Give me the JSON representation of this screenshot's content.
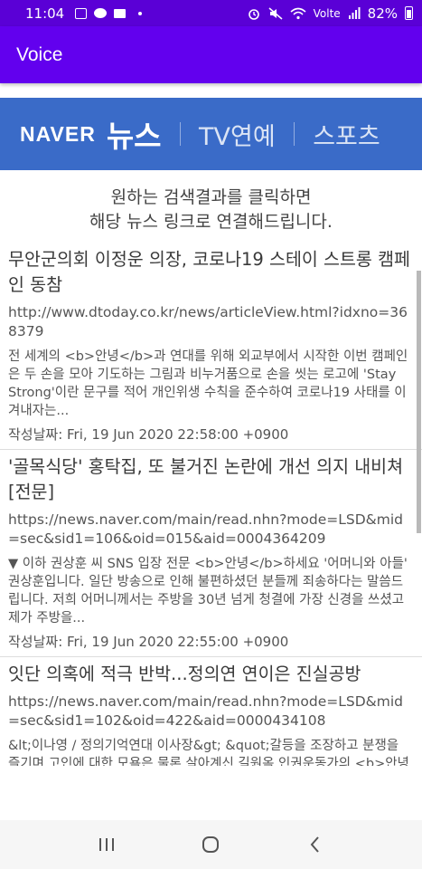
{
  "status": {
    "time": "11:04",
    "battery": "82%",
    "net_label": "Volte"
  },
  "app": {
    "title": "Voice"
  },
  "banner": {
    "brand": "NAVER",
    "news": "뉴스",
    "tab_entertainment": "TV연예",
    "tab_sports": "스포츠"
  },
  "intro": {
    "line1": "원하는 검색결과를 클릭하면",
    "line2": "해당 뉴스 링크로 연결해드립니다."
  },
  "results": [
    {
      "title": "무안군의회 이정운 의장, 코로나19 스테이 스트롱 캠페인 동참",
      "link": "http://www.dtoday.co.kr/news/articleView.html?idxno=368379",
      "desc": "전 세계의 <b>안녕</b>과 연대를 위해 외교부에서 시작한 이번 캠페인은 두 손을 모아 기도하는 그림과 비누거품으로 손을 씻는 로고에 'Stay Strong'이란 문구를 적어 개인위생 수칙을 준수하여 코로나19 사태를 이겨내자는...",
      "date": "작성날짜: Fri, 19 Jun 2020 22:58:00 +0900"
    },
    {
      "title": "'골목식당' 홍탁집, 또 불거진 논란에 개선 의지 내비쳐 [전문]",
      "link": "https://news.naver.com/main/read.nhn?mode=LSD&mid=sec&sid1=106&oid=015&aid=0004364209",
      "desc": "▼ 이하 권상훈 씨 SNS 입장 전문 <b>안녕</b>하세요 '어머니와 아들' 권상훈입니다. 일단 방송으로 인해 불편하셨던 분들께 죄송하다는 말씀드립니다. 저희 어머니께서는 주방을 30년 넘게 청결에 가장 신경을 쓰셨고 제가 주방을...",
      "date": "작성날짜: Fri, 19 Jun 2020 22:55:00 +0900"
    },
    {
      "title": "잇단 의혹에 적극 반박...정의연 연이은 진실공방",
      "link": "https://news.naver.com/main/read.nhn?mode=LSD&mid=sec&sid1=102&oid=422&aid=0000434108",
      "desc": "&lt;이나영 / 정의기억연대 이사장&gt; &quot;갈등을 조장하고 분쟁을 즐기며 고인에 대한 모욕은 물론 살아계신 길원옥 인권운동가의 <b>안녕</b>과 명예에 심각한 손상을 가하고",
      "date": ""
    }
  ]
}
